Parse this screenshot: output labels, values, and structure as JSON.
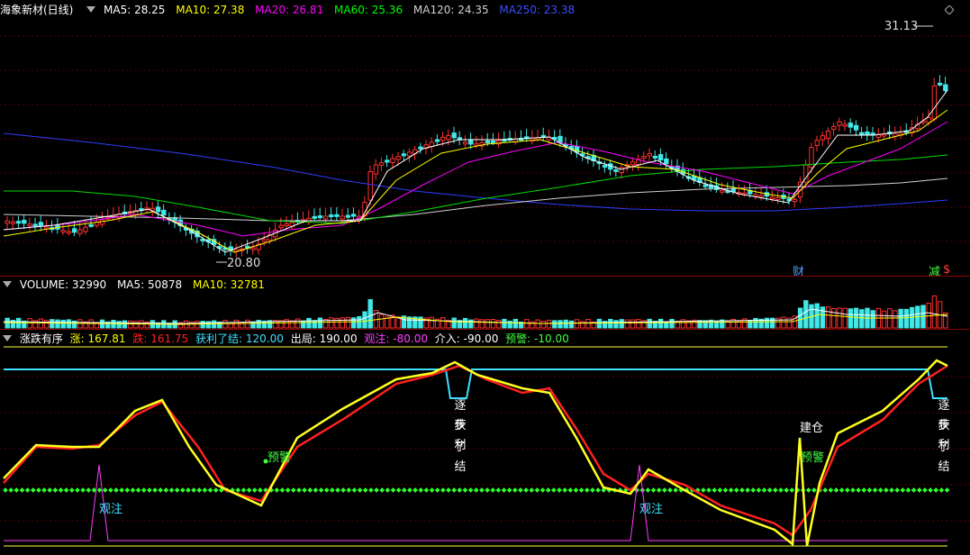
{
  "main": {
    "title": "海象新材(日线)",
    "ma": [
      {
        "label": "MA5: 28.25",
        "color": "#ffffff"
      },
      {
        "label": "MA10: 27.38",
        "color": "#ffff00"
      },
      {
        "label": "MA20: 26.81",
        "color": "#ff00ff"
      },
      {
        "label": "MA60: 25.36",
        "color": "#00ff00"
      },
      {
        "label": "MA120: 24.35",
        "color": "#d0d0d0"
      },
      {
        "label": "MA250: 23.38",
        "color": "#3a4cff"
      }
    ],
    "high_label": "31.13",
    "low_label": "20.80",
    "marker_cai": "财",
    "marker_jian": "减",
    "marker_s": "$"
  },
  "volume": {
    "labels": [
      {
        "label": "VOLUME: 32990",
        "color": "#ffffff"
      },
      {
        "label": "MA5: 50878",
        "color": "#ffffff"
      },
      {
        "label": "MA10: 32781",
        "color": "#ffff00"
      }
    ]
  },
  "indicator": {
    "name": "涨跌有序",
    "items": [
      {
        "label": "涨: 167.81",
        "color": "#ffff00"
      },
      {
        "label": "跌: 161.75",
        "color": "#ff2020"
      },
      {
        "label": "获利了结: 120.00",
        "color": "#40e0ff"
      },
      {
        "label": "出局: 190.00",
        "color": "#ffffff"
      },
      {
        "label": "观注: -80.00",
        "color": "#ff40ff"
      },
      {
        "label": "介入: -90.00",
        "color": "#ffffff"
      },
      {
        "label": "预警: -10.00",
        "color": "#40ff40"
      }
    ],
    "signals": {
      "zhubu": [
        "逐",
        "步"
      ],
      "huoli": [
        "获",
        "利"
      ],
      "liaojie": [
        "了",
        "结"
      ],
      "jiancang": "建仓",
      "yujing": "预警",
      "guanzhu": "观注"
    }
  },
  "icons": {
    "pane_toggle": "triangle-down-icon",
    "corner": "diamond-icon"
  }
}
